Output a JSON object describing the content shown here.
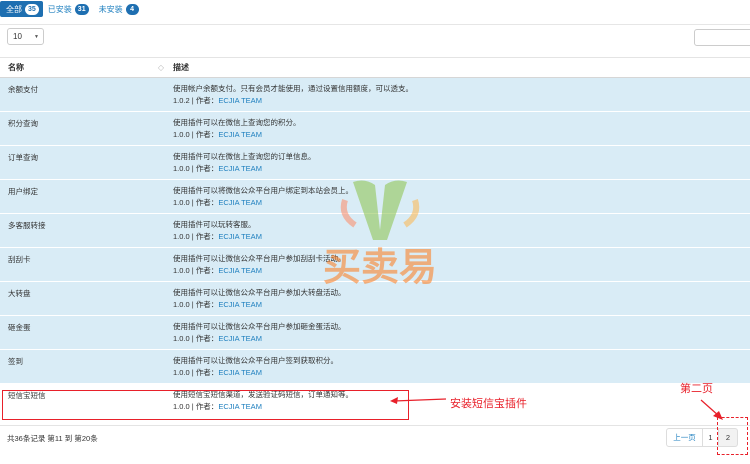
{
  "tabs": [
    {
      "label": "全部",
      "count": "35"
    },
    {
      "label": "已安装",
      "count": "31"
    },
    {
      "label": "未安装",
      "count": "4"
    }
  ],
  "page_size": "10",
  "table": {
    "headers": {
      "name": "名称",
      "desc": "描述"
    },
    "rows": [
      {
        "name": "余额支付",
        "desc": "使用帐户余额支付。只有会员才能使用，通过设置信用额度，可以透支。",
        "version": "1.0.2",
        "author_label": "作者：",
        "author": "ECJIA TEAM"
      },
      {
        "name": "积分查询",
        "desc": "使用插件可以在微信上查询您的积分。",
        "version": "1.0.0",
        "author_label": "作者：",
        "author": "ECJIA TEAM"
      },
      {
        "name": "订单查询",
        "desc": "使用插件可以在微信上查询您的订单信息。",
        "version": "1.0.0",
        "author_label": "作者：",
        "author": "ECJIA TEAM"
      },
      {
        "name": "用户绑定",
        "desc": "使用插件可以将微信公众平台用户绑定到本站会员上。",
        "version": "1.0.0",
        "author_label": "作者：",
        "author": "ECJIA TEAM"
      },
      {
        "name": "多客服转接",
        "desc": "使用插件可以玩转客服。",
        "version": "1.0.0",
        "author_label": "作者：",
        "author": "ECJIA TEAM"
      },
      {
        "name": "刮刮卡",
        "desc": "使用插件可以让微信公众平台用户参加刮刮卡活动。",
        "version": "1.0.0",
        "author_label": "作者：",
        "author": "ECJIA TEAM"
      },
      {
        "name": "大转盘",
        "desc": "使用插件可以让微信公众平台用户参加大转盘活动。",
        "version": "1.0.0",
        "author_label": "作者：",
        "author": "ECJIA TEAM"
      },
      {
        "name": "砸金蛋",
        "desc": "使用插件可以让微信公众平台用户参加砸金蛋活动。",
        "version": "1.0.0",
        "author_label": "作者：",
        "author": "ECJIA TEAM"
      },
      {
        "name": "签到",
        "desc": "使用插件可以让微信公众平台用户签到获取积分。",
        "version": "1.0.0",
        "author_label": "作者：",
        "author": "ECJIA TEAM"
      },
      {
        "name": "短信宝短信",
        "desc": "使用短信宝短信渠道，发送验证码短信，订单通知等。",
        "version": "1.0.0",
        "author_label": "作者：",
        "author": "ECJIA TEAM"
      }
    ]
  },
  "footer": {
    "info": "共36条记录 第11 到 第20条",
    "prev": "上一页",
    "page1": "1",
    "page2": "2"
  },
  "annotations": {
    "install_label": "安装短信宝插件",
    "page_two_label": "第二页",
    "color": "#e8202a"
  },
  "watermark": {
    "text": "买卖易"
  },
  "colors": {
    "accent": "#1e6fb1",
    "row_highlight": "#d9ecf6",
    "link": "#1e7fbf"
  }
}
